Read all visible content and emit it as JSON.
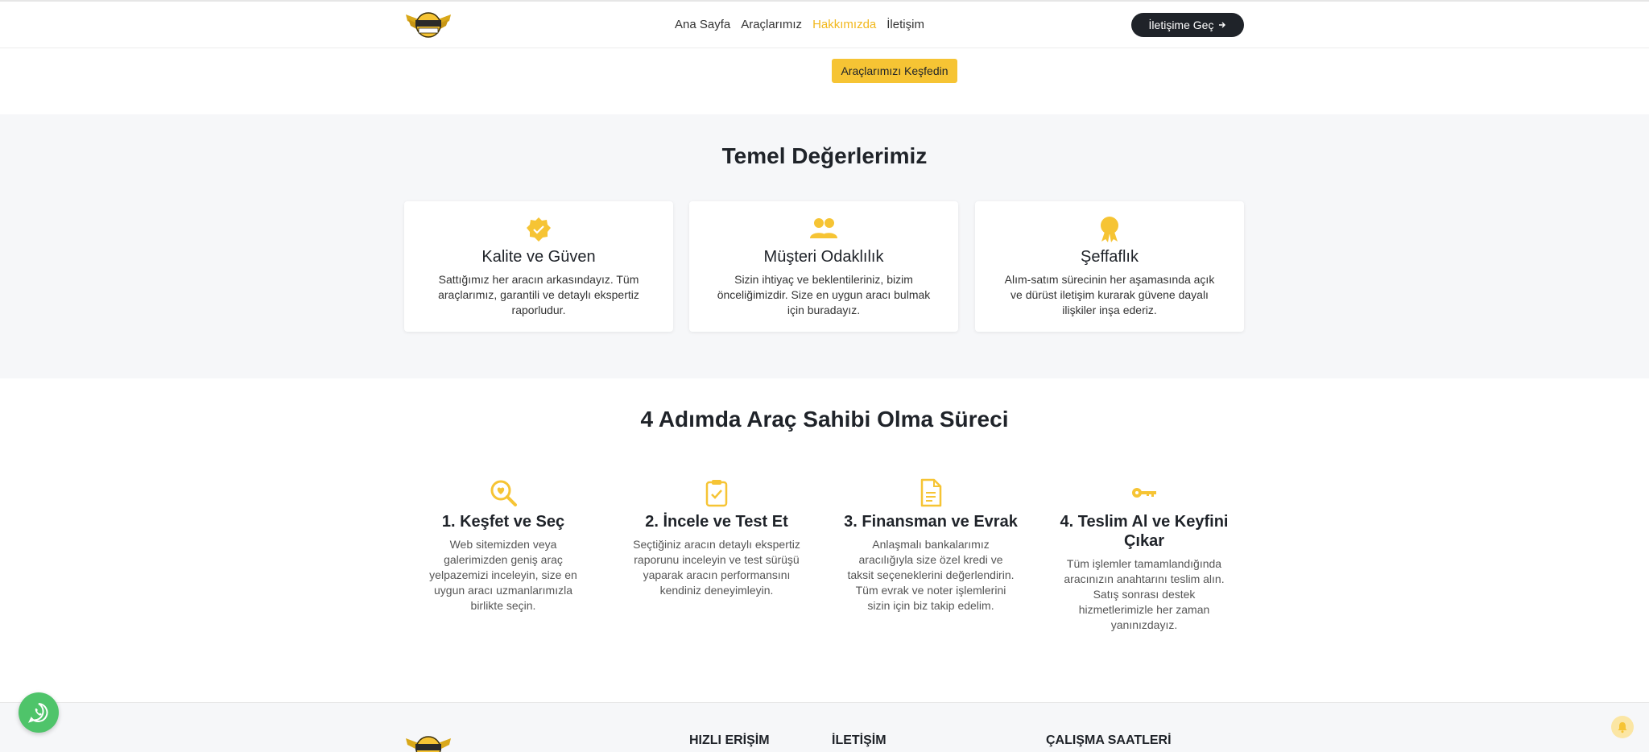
{
  "header": {
    "logo_icon": "winged-badge-logo",
    "nav": [
      {
        "label": "Ana Sayfa",
        "active": false
      },
      {
        "label": "Araçlarımız",
        "active": false
      },
      {
        "label": "Hakkımızda",
        "active": true
      },
      {
        "label": "İletişim",
        "active": false
      }
    ],
    "cta_label": "İletişime Geç",
    "cta_icon": "arrow-right-icon"
  },
  "hero": {
    "explore_label": "Araçlarımızı Keşfedin"
  },
  "values": {
    "title": "Temel Değerlerimiz",
    "cards": [
      {
        "icon": "verified-badge-icon",
        "title": "Kalite ve Güven",
        "text": "Sattığımız her aracın arkasındayız. Tüm araçlarımız, garantili ve detaylı ekspertiz raporludur."
      },
      {
        "icon": "users-icon",
        "title": "Müşteri Odaklılık",
        "text": "Sizin ihtiyaç ve beklentileriniz, bizim önceliğimizdir. Size en uygun aracı bulmak için buradayız."
      },
      {
        "icon": "award-icon",
        "title": "Şeffaflık",
        "text": "Alım-satım sürecinin her aşamasında açık ve dürüst iletişim kurarak güvene dayalı ilişkiler inşa ederiz."
      }
    ]
  },
  "steps": {
    "title": "4 Adımda Araç Sahibi Olma Süreci",
    "items": [
      {
        "icon": "search-heart-icon",
        "title": "1. Keşfet ve Seç",
        "text": "Web sitemizden veya galerimizden geniş araç yelpazemizi inceleyin, size en uygun aracı uzmanlarımızla birlikte seçin."
      },
      {
        "icon": "clipboard-check-icon",
        "title": "2. İncele ve Test Et",
        "text": "Seçtiğiniz aracın detaylı ekspertiz raporunu inceleyin ve test sürüşü yaparak aracın performansını kendiniz deneyimleyin."
      },
      {
        "icon": "document-icon",
        "title": "3. Finansman ve Evrak",
        "text": "Anlaşmalı bankalarımız aracılığıyla size özel kredi ve taksit seçeneklerini değerlendirin. Tüm evrak ve noter işlemlerini sizin için biz takip edelim."
      },
      {
        "icon": "key-icon",
        "title": "4. Teslim Al ve Keyfini Çıkar",
        "text": "Tüm işlemler tamamlandığında aracınızın anahtarını teslim alın. Satış sonrası destek hizmetlerimizle her zaman yanınızdayız."
      }
    ]
  },
  "footer": {
    "headings": [
      "HIZLI ERİŞİM",
      "İLETİŞİM",
      "ÇALIŞMA SAATLERİ"
    ]
  },
  "floating": {
    "whatsapp_icon": "whatsapp-icon",
    "bell_icon": "bell-icon"
  },
  "colors": {
    "accent": "#f6c434",
    "accent_text": "#f2b81d",
    "dark": "#1f2329",
    "whatsapp": "#4fc46a"
  }
}
